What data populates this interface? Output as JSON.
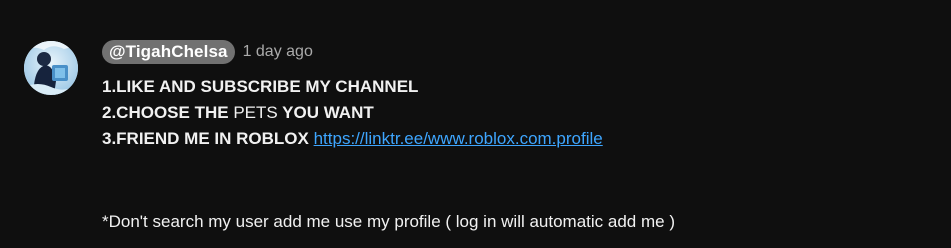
{
  "comment": {
    "author": "@TigahChelsa",
    "timestamp": "1 day ago",
    "lines": [
      {
        "bold_a": "1.LIKE AND SUBSCRIBE MY CHANNEL"
      },
      {
        "bold_a": "2.CHOOSE THE",
        "plain": " PETS",
        "bold_b": " YOU WANT"
      },
      {
        "bold_a": "3.FRIEND ME IN ROBLOX",
        "link": "https://linktr.ee/www.roblox.com.profile"
      }
    ],
    "note": "*Don't search my user add me use my profile ( log in will automatic add me )"
  },
  "colors": {
    "background": "#0f0f0f",
    "text": "#f1f1f1",
    "author_badge": "#717171",
    "timestamp": "#aaaaaa",
    "link": "#3ea6ff"
  },
  "icons": {
    "avatar": "user-avatar-image"
  }
}
